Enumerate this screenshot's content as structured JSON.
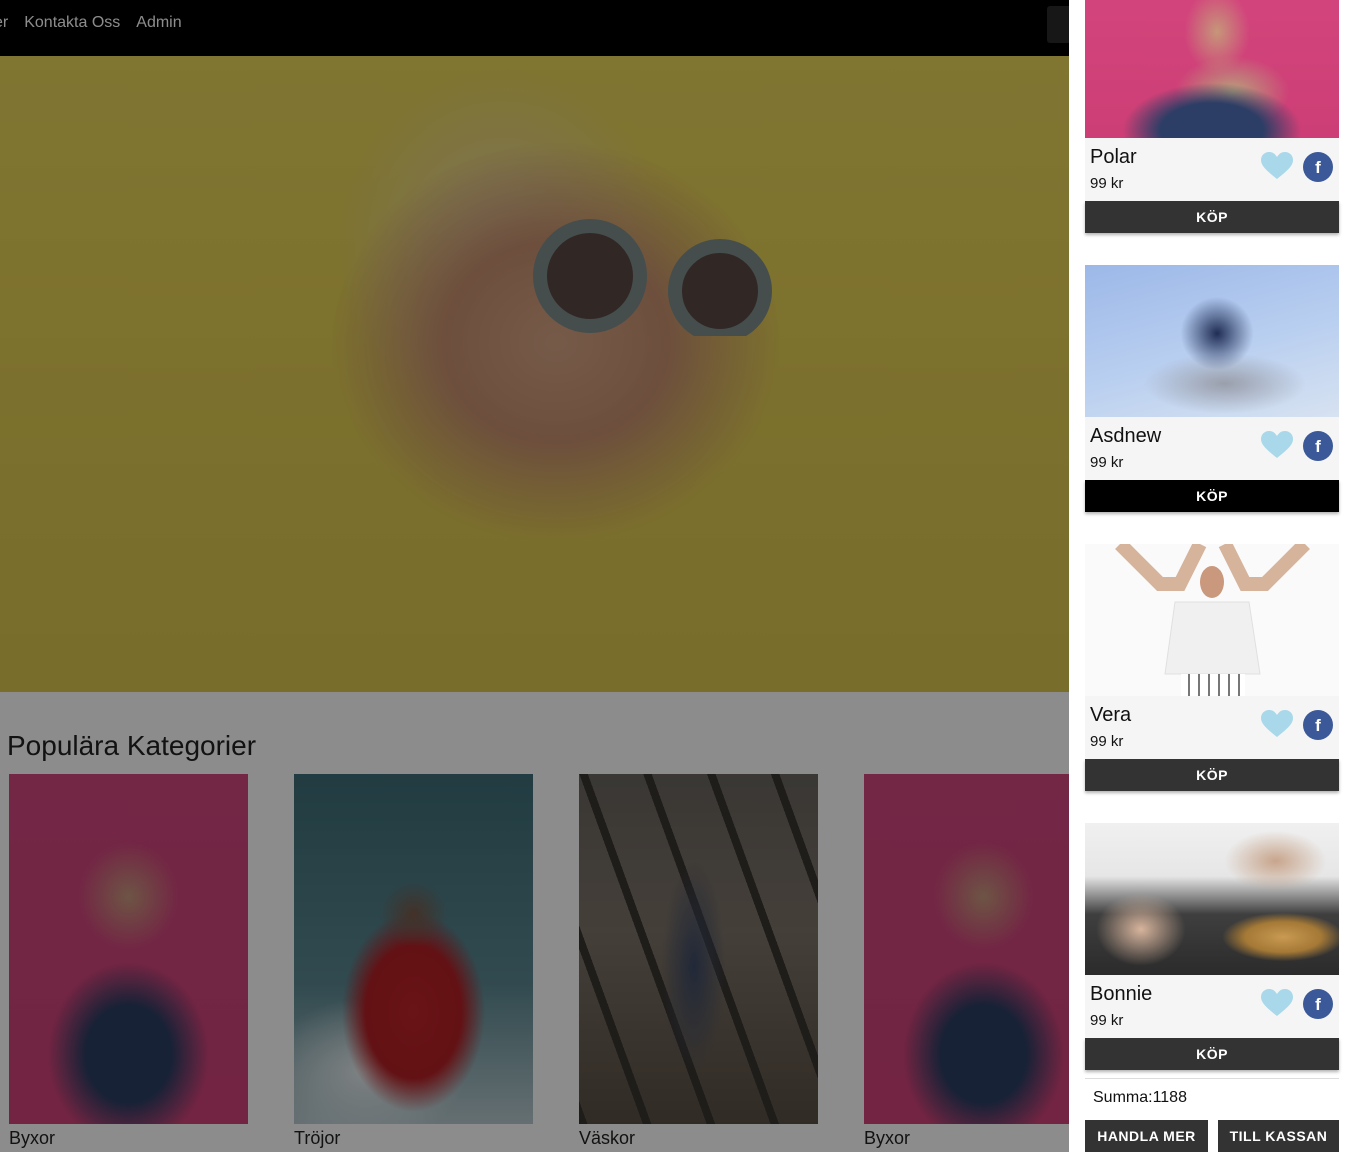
{
  "nav": {
    "links": [
      "er",
      "Kontakta Oss",
      "Admin"
    ]
  },
  "main": {
    "section_title": "Populära Kategorier",
    "categories": [
      {
        "label": "Byxor"
      },
      {
        "label": "Tröjor"
      },
      {
        "label": "Väskor"
      },
      {
        "label": "Byxor"
      }
    ]
  },
  "cart": {
    "items": [
      {
        "name": "Polar",
        "price": "99 kr",
        "buy_label": "KÖP"
      },
      {
        "name": "Asdnew",
        "price": "99 kr",
        "buy_label": "KÖP"
      },
      {
        "name": "Vera",
        "price": "99 kr",
        "buy_label": "KÖP"
      },
      {
        "name": "Bonnie",
        "price": "99 kr",
        "buy_label": "KÖP"
      }
    ],
    "facebook_glyph": "f",
    "sum_text": "Summa:1188",
    "continue_label": "HANDLA MER",
    "checkout_label": "TILL KASSAN"
  },
  "colors": {
    "heart": "#a8d8ea",
    "facebook": "#3b5998",
    "button": "#333333",
    "button_active": "#000000"
  },
  "icons": {
    "like": "heart-icon",
    "share": "facebook-icon"
  }
}
